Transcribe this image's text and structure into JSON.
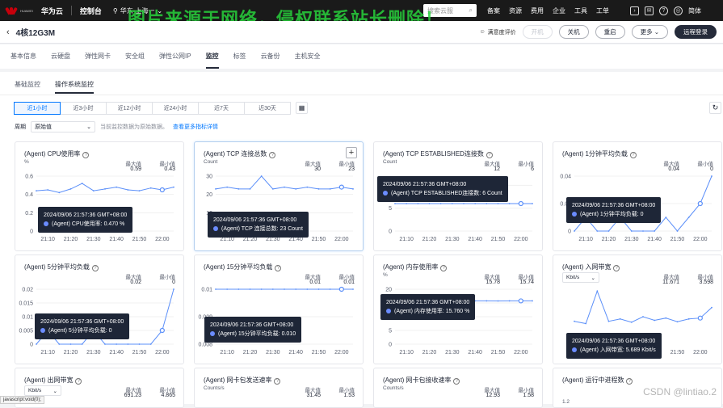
{
  "topbar": {
    "logo_text": "HUAWEI",
    "brand": "华为云",
    "console": "控制台",
    "region": "华东-上海一",
    "search_placeholder": "搜索云服",
    "nav": [
      "备案",
      "资源",
      "费用",
      "企业",
      "工具",
      "工单"
    ],
    "lang": "简体"
  },
  "watermark": "图片来源于网络，侵权联系站长删除！",
  "header": {
    "title": "4核12G3M",
    "satisfaction": "满意度评价",
    "buttons": [
      "开机",
      "关机",
      "重启",
      "更多",
      "远程登录"
    ]
  },
  "tabs": [
    "基本信息",
    "云硬盘",
    "弹性网卡",
    "安全组",
    "弹性公网IP",
    "监控",
    "标签",
    "云备份",
    "主机安全"
  ],
  "active_tab": "监控",
  "subtabs": [
    "基础监控",
    "操作系统监控"
  ],
  "ranges": [
    "近1小时",
    "近3小时",
    "近12小时",
    "近24小时",
    "近7天",
    "近30天"
  ],
  "period": {
    "label": "周期",
    "value": "原始值",
    "note": "当前监控数据为原始数据。",
    "link": "查看更多指标详情"
  },
  "labels": {
    "max": "最大值",
    "min": "最小值"
  },
  "colors": {
    "series": "#5b8ff9",
    "accent": "#0077ff",
    "tooltip_bg": "#1e2637"
  },
  "cards": [
    {
      "title": "(Agent) CPU使用率",
      "unit": "%",
      "max": "0.59",
      "min": "0.43",
      "yticks": [
        "0.6",
        "0.4",
        "0.2",
        "0"
      ],
      "xticks": [
        "21:10",
        "21:20",
        "21:30",
        "21:40",
        "21:50",
        "22:00"
      ],
      "tip_time": "2024/09/06 21:57:36 GMT+08:00",
      "tip_value": "(Agent) CPU使用率: 0.470 %"
    },
    {
      "title": "(Agent) TCP 连接总数",
      "unit": "Count",
      "max": "30",
      "min": "23",
      "yticks": [
        "30",
        "20",
        "10",
        "0"
      ],
      "xticks": [
        "21:10",
        "21:20",
        "21:30",
        "21:40",
        "21:50",
        "22:00"
      ],
      "tip_time": "2024/09/06 21:57:36 GMT+08:00",
      "tip_value": "(Agent) TCP 连接总数: 23 Count"
    },
    {
      "title": "(Agent) TCP ESTABLISHED连接数",
      "unit": "Count",
      "max": "12",
      "min": "6",
      "yticks": [
        "10",
        "5",
        "0"
      ],
      "xticks": [
        "21:10",
        "21:20",
        "21:30",
        "21:40",
        "21:50",
        "22:00"
      ],
      "tip_time": "2024/09/06 21:57:36 GMT+08:00",
      "tip_value": "(Agent) TCP ESTABLISHED连接数: 6 Count"
    },
    {
      "title": "(Agent) 1分钟平均负载",
      "unit": "",
      "max": "0.04",
      "min": "0",
      "yticks": [
        "0.04",
        "0.02",
        "0"
      ],
      "xticks": [
        "21:10",
        "21:20",
        "21:30",
        "21:40",
        "21:50",
        "22:00"
      ],
      "tip_time": "2024/09/06 21:57:36 GMT+08:00",
      "tip_value": "(Agent) 1分钟平均负载: 0"
    },
    {
      "title": "(Agent) 5分钟平均负载",
      "unit": "",
      "max": "0.02",
      "min": "0",
      "yticks": [
        "0.02",
        "0.015",
        "0.01",
        "0.005",
        "0"
      ],
      "xticks": [
        "21:10",
        "21:20",
        "21:30",
        "21:40",
        "21:50",
        "22:00"
      ],
      "tip_time": "2024/09/06 21:57:36 GMT+08:00",
      "tip_value": "(Agent) 5分钟平均负载: 0"
    },
    {
      "title": "(Agent) 15分钟平均负载",
      "unit": "",
      "max": "0.01",
      "min": "0.01",
      "yticks": [
        "0.01",
        "0.009",
        "0.008"
      ],
      "xticks": [
        "21:10",
        "21:20",
        "21:30",
        "21:40",
        "21:50",
        "22:00"
      ],
      "tip_time": "2024/09/06 21:57:36 GMT+08:00",
      "tip_value": "(Agent) 15分钟平均负载: 0.010"
    },
    {
      "title": "(Agent) 内存使用率",
      "unit": "%",
      "max": "15.78",
      "min": "15.74",
      "yticks": [
        "20",
        "15",
        "10",
        "5",
        "0"
      ],
      "xticks": [
        "21:10",
        "21:20",
        "21:30",
        "21:40",
        "21:50",
        "22:00"
      ],
      "tip_time": "2024/09/06 21:57:36 GMT+08:00",
      "tip_value": "(Agent) 内存使用率: 15.760 %"
    },
    {
      "title": "(Agent) 入网带宽",
      "unit": "Kbit/s",
      "max": "11.671",
      "min": "3.598",
      "yticks": [],
      "xticks": [
        "21:10",
        "21:20",
        "21:30",
        "21:40",
        "21:50",
        "22:00"
      ],
      "tip_time": "2024/09/06 21:57:36 GMT+08:00",
      "tip_value": "(Agent) 入网带宽: 5.689 Kbit/s"
    },
    {
      "title": "(Agent) 出网带宽",
      "unit": "Kbit/s",
      "max": "691.23",
      "min": "4.865"
    },
    {
      "title": "(Agent) 网卡包发送速率",
      "unit": "Counts/s",
      "max": "31.45",
      "min": "1.53"
    },
    {
      "title": "(Agent) 网卡包接收速率",
      "unit": "Counts/s",
      "max": "12.93",
      "min": "1.58"
    },
    {
      "title": "(Agent) 运行中进程数",
      "unit": "",
      "max": "",
      "min": "",
      "yticks": [
        "1.2"
      ]
    }
  ],
  "chart_data": [
    {
      "type": "line",
      "title": "(Agent) CPU使用率",
      "ylabel": "%",
      "ylim": [
        0,
        0.6
      ],
      "x": [
        "21:05",
        "21:10",
        "21:15",
        "21:20",
        "21:25",
        "21:30",
        "21:35",
        "21:40",
        "21:45",
        "21:50",
        "21:55",
        "22:00",
        "22:05"
      ],
      "series": [
        {
          "values": [
            0.44,
            0.45,
            0.42,
            0.46,
            0.52,
            0.44,
            0.46,
            0.48,
            0.45,
            0.44,
            0.47,
            0.45,
            0.48
          ]
        }
      ]
    },
    {
      "type": "line",
      "title": "(Agent) TCP 连接总数",
      "ylabel": "Count",
      "ylim": [
        0,
        30
      ],
      "x": [
        "21:05",
        "21:10",
        "21:15",
        "21:20",
        "21:25",
        "21:30",
        "21:35",
        "21:40",
        "21:45",
        "21:50",
        "21:55",
        "22:00",
        "22:05"
      ],
      "series": [
        {
          "values": [
            23,
            24,
            23,
            23,
            30,
            23,
            24,
            23,
            24,
            23,
            23,
            24,
            23
          ]
        }
      ]
    },
    {
      "type": "line",
      "title": "(Agent) TCP ESTABLISHED连接数",
      "ylabel": "Count",
      "ylim": [
        0,
        12
      ],
      "x": [
        "21:05",
        "21:10",
        "21:15",
        "21:20",
        "21:25",
        "21:30",
        "21:35",
        "21:40",
        "21:45",
        "21:50",
        "21:55",
        "22:00",
        "22:05"
      ],
      "series": [
        {
          "values": [
            6,
            6,
            6,
            6,
            6,
            6,
            6,
            6,
            6,
            6,
            6,
            6,
            6
          ]
        }
      ]
    },
    {
      "type": "line",
      "title": "(Agent) 1分钟平均负载",
      "ylim": [
        0,
        0.04
      ],
      "x": [
        "21:05",
        "21:10",
        "21:15",
        "21:20",
        "21:25",
        "21:30",
        "21:35",
        "21:40",
        "21:45",
        "21:50",
        "21:55",
        "22:00",
        "22:05"
      ],
      "series": [
        {
          "values": [
            0,
            0.01,
            0,
            0,
            0.01,
            0,
            0,
            0,
            0.01,
            0,
            0.01,
            0.02,
            0.04
          ]
        }
      ]
    },
    {
      "type": "line",
      "title": "(Agent) 5分钟平均负载",
      "ylim": [
        0,
        0.02
      ],
      "x": [
        "21:05",
        "21:10",
        "21:15",
        "21:20",
        "21:25",
        "21:30",
        "21:35",
        "21:40",
        "21:45",
        "21:50",
        "21:55",
        "22:00",
        "22:05"
      ],
      "series": [
        {
          "values": [
            0,
            0.005,
            0,
            0,
            0,
            0.005,
            0,
            0,
            0,
            0,
            0,
            0.005,
            0.02
          ]
        }
      ]
    },
    {
      "type": "line",
      "title": "(Agent) 15分钟平均负载",
      "ylim": [
        0.008,
        0.01
      ],
      "x": [
        "21:05",
        "21:10",
        "21:15",
        "21:20",
        "21:25",
        "21:30",
        "21:35",
        "21:40",
        "21:45",
        "21:50",
        "21:55",
        "22:00",
        "22:05"
      ],
      "series": [
        {
          "values": [
            0.01,
            0.01,
            0.01,
            0.01,
            0.01,
            0.01,
            0.01,
            0.01,
            0.01,
            0.01,
            0.01,
            0.01,
            0.01
          ]
        }
      ]
    },
    {
      "type": "line",
      "title": "(Agent) 内存使用率",
      "ylabel": "%",
      "ylim": [
        0,
        20
      ],
      "x": [
        "21:05",
        "21:10",
        "21:15",
        "21:20",
        "21:25",
        "21:30",
        "21:35",
        "21:40",
        "21:45",
        "21:50",
        "21:55",
        "22:00",
        "22:05"
      ],
      "series": [
        {
          "values": [
            15.76,
            15.76,
            15.75,
            15.76,
            15.78,
            15.76,
            15.75,
            15.76,
            15.76,
            15.74,
            15.76,
            15.76,
            15.76
          ]
        }
      ]
    },
    {
      "type": "line",
      "title": "(Agent) 入网带宽",
      "ylabel": "Kbit/s",
      "ylim": [
        0,
        12
      ],
      "x": [
        "21:05",
        "21:10",
        "21:15",
        "21:20",
        "21:25",
        "21:30",
        "21:35",
        "21:40",
        "21:45",
        "21:50",
        "21:55",
        "22:00",
        "22:05"
      ],
      "series": [
        {
          "values": [
            5,
            4.5,
            11.6,
            5,
            5.5,
            4.8,
            6,
            5.2,
            5.7,
            4.9,
            5.5,
            5.7,
            8
          ]
        }
      ]
    }
  ]
}
